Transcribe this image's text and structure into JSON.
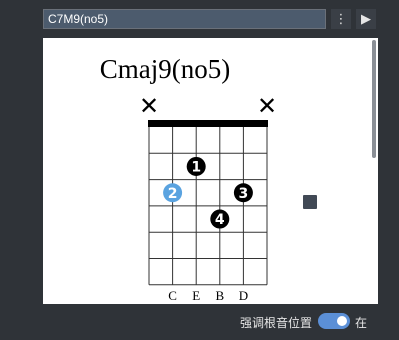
{
  "toolbar": {
    "chord_input_value": "C7M9(no5)",
    "menu_icon": "more-vertical-icon",
    "menu_glyph": "⋮",
    "play_icon": "play-icon",
    "play_glyph": "▶"
  },
  "diagram": {
    "title": "Cmaj9(no5)",
    "muted_marker": "✕",
    "muted_strings": [
      1,
      6
    ],
    "fret_count": 6,
    "string_count": 6,
    "fingers": [
      {
        "finger": "1",
        "string": 3,
        "fret": 2,
        "root": false
      },
      {
        "finger": "2",
        "string": 2,
        "fret": 3,
        "root": true
      },
      {
        "finger": "3",
        "string": 5,
        "fret": 3,
        "root": false
      },
      {
        "finger": "4",
        "string": 4,
        "fret": 4,
        "root": false
      }
    ],
    "notes": [
      "C",
      "E",
      "B",
      "D"
    ],
    "note_strings": [
      2,
      3,
      4,
      5
    ],
    "colors": {
      "dot": "#000000",
      "root_dot": "#5aa3e0",
      "nut": "#000000",
      "grid": "#333333",
      "side_marker": "#414955"
    }
  },
  "footer": {
    "toggle_label": "强调根音位置",
    "toggle_on": true,
    "toggle_state": "在",
    "accent_color": "#5b8fd6"
  }
}
